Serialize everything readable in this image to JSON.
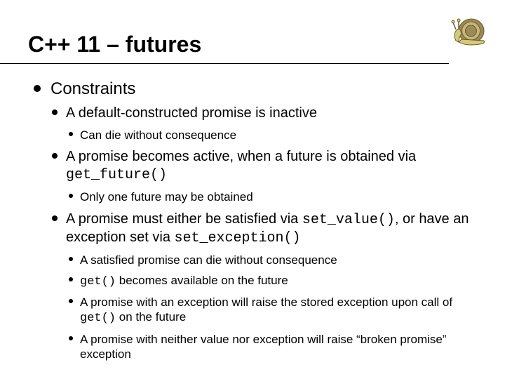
{
  "title": "C++ 11 – futures",
  "l0": "Constraints",
  "b1": "A default-constructed promise is inactive",
  "b1a": "Can die without consequence",
  "b2_pre": "A promise becomes active, when a future is obtained via ",
  "b2_code": "get_future()",
  "b2a": "Only one future may be obtained",
  "b3_pre": "A promise must either be satisfied via ",
  "b3_code1": "set_value()",
  "b3_mid": ", or have an exception set via ",
  "b3_code2": "set_exception()",
  "b3a": "A satisfied promise can die without consequence",
  "b3b_code": "get()",
  "b3b_post": " becomes available on the future",
  "b3c_pre": "A promise with an exception will raise the stored exception upon call of ",
  "b3c_code": "get()",
  "b3c_post": " on the future",
  "b3d": "A promise with neither value nor exception will raise “broken promise” exception"
}
